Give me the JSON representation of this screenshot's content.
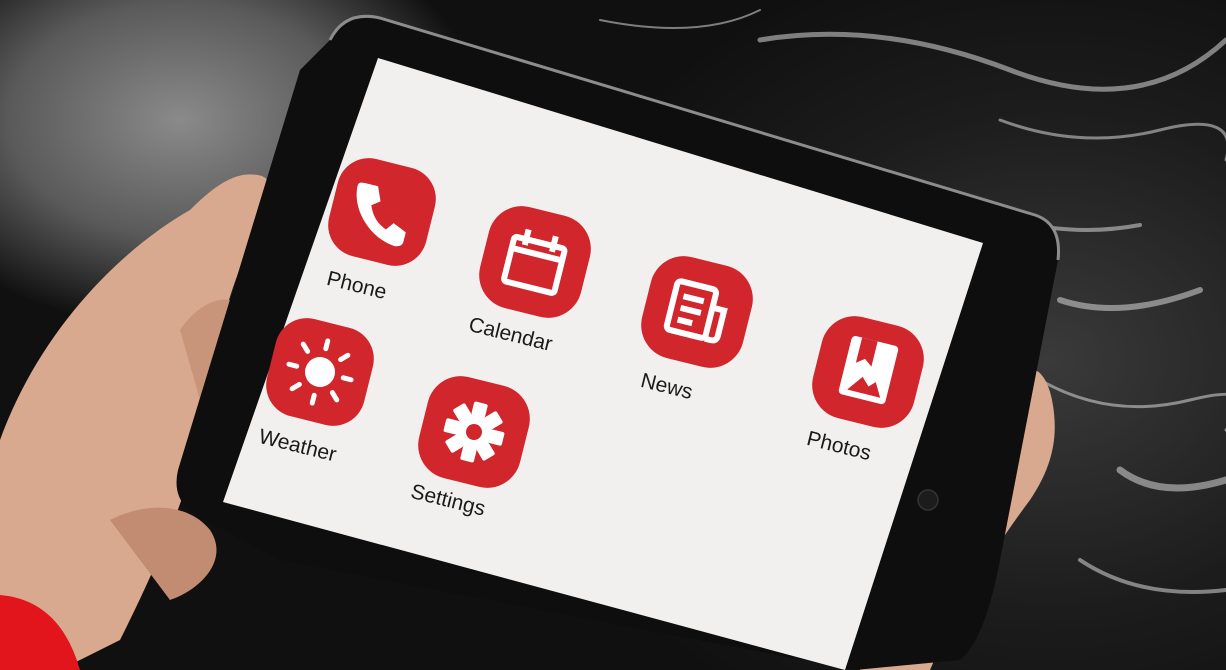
{
  "apps": [
    {
      "label": "Phone",
      "icon": "phone-icon"
    },
    {
      "label": "Calendar",
      "icon": "calendar-icon"
    },
    {
      "label": "News",
      "icon": "news-icon"
    },
    {
      "label": "Photos",
      "icon": "photos-icon"
    },
    {
      "label": "Weather",
      "icon": "sun-icon"
    },
    {
      "label": "Settings",
      "icon": "gear-icon"
    }
  ],
  "colors": {
    "accent": "#d0262c",
    "screen": "#f2f0ee",
    "bezel": "#0e0e0e"
  }
}
